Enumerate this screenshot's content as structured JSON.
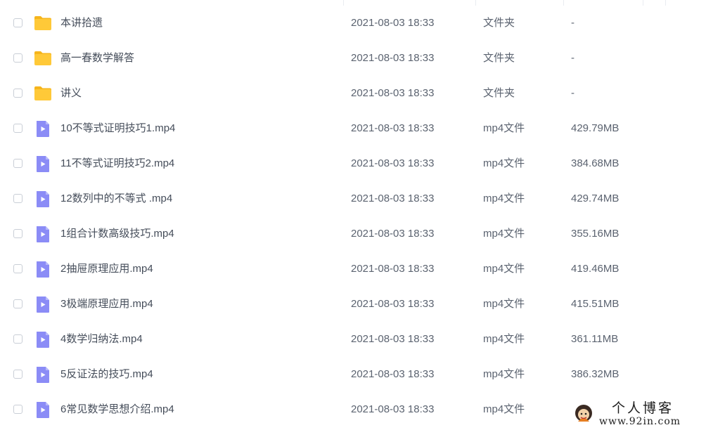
{
  "files": [
    {
      "name": "本讲拾遗",
      "date": "2021-08-03 18:33",
      "type": "文件夹",
      "size": "-",
      "icon": "folder-icon"
    },
    {
      "name": "高一春数学解答",
      "date": "2021-08-03 18:33",
      "type": "文件夹",
      "size": "-",
      "icon": "folder-icon"
    },
    {
      "name": "讲义",
      "date": "2021-08-03 18:33",
      "type": "文件夹",
      "size": "-",
      "icon": "folder-icon"
    },
    {
      "name": "10不等式证明技巧1.mp4",
      "date": "2021-08-03 18:33",
      "type": "mp4文件",
      "size": "429.79MB",
      "icon": "video-file-icon"
    },
    {
      "name": "11不等式证明技巧2.mp4",
      "date": "2021-08-03 18:33",
      "type": "mp4文件",
      "size": "384.68MB",
      "icon": "video-file-icon"
    },
    {
      "name": "12数列中的不等式 .mp4",
      "date": "2021-08-03 18:33",
      "type": "mp4文件",
      "size": "429.74MB",
      "icon": "video-file-icon"
    },
    {
      "name": "1组合计数高级技巧.mp4",
      "date": "2021-08-03 18:33",
      "type": "mp4文件",
      "size": "355.16MB",
      "icon": "video-file-icon"
    },
    {
      "name": "2抽屉原理应用.mp4",
      "date": "2021-08-03 18:33",
      "type": "mp4文件",
      "size": "419.46MB",
      "icon": "video-file-icon"
    },
    {
      "name": "3极端原理应用.mp4",
      "date": "2021-08-03 18:33",
      "type": "mp4文件",
      "size": "415.51MB",
      "icon": "video-file-icon"
    },
    {
      "name": "4数学归纳法.mp4",
      "date": "2021-08-03 18:33",
      "type": "mp4文件",
      "size": "361.11MB",
      "icon": "video-file-icon"
    },
    {
      "name": "5反证法的技巧.mp4",
      "date": "2021-08-03 18:33",
      "type": "mp4文件",
      "size": "386.32MB",
      "icon": "video-file-icon"
    },
    {
      "name": "6常见数学思想介绍.mp4",
      "date": "2021-08-03 18:33",
      "type": "mp4文件",
      "size": "",
      "icon": "video-file-icon"
    }
  ],
  "watermark": {
    "title": "个人博客",
    "url": "www.92in.com"
  },
  "colors": {
    "folder": "#ffc938",
    "folder_tab": "#f6b51c",
    "video": "#8b8cf6",
    "video_fold": "#b7b8fb",
    "text": "#454d5a",
    "divider": "#e9ecf1"
  }
}
